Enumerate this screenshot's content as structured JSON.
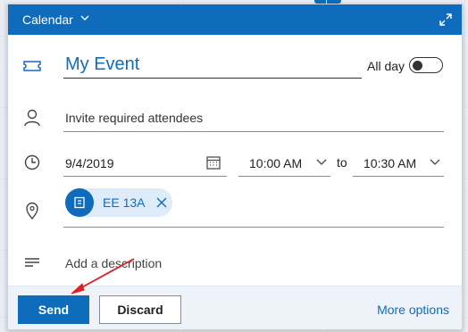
{
  "header": {
    "title": "Calendar"
  },
  "event": {
    "title": "My Event",
    "all_day_label": "All day",
    "all_day_on": false
  },
  "attendees": {
    "placeholder": "Invite required attendees"
  },
  "when": {
    "date": "9/4/2019",
    "start_time": "10:00 AM",
    "to_label": "to",
    "end_time": "10:30 AM"
  },
  "location": {
    "chip_name": "EE 13A"
  },
  "description": {
    "placeholder": "Add a description"
  },
  "footer": {
    "send_label": "Send",
    "discard_label": "Discard",
    "more_options_label": "More options"
  },
  "colors": {
    "accent": "#0f6cbd",
    "annotation_arrow": "#e02020"
  }
}
